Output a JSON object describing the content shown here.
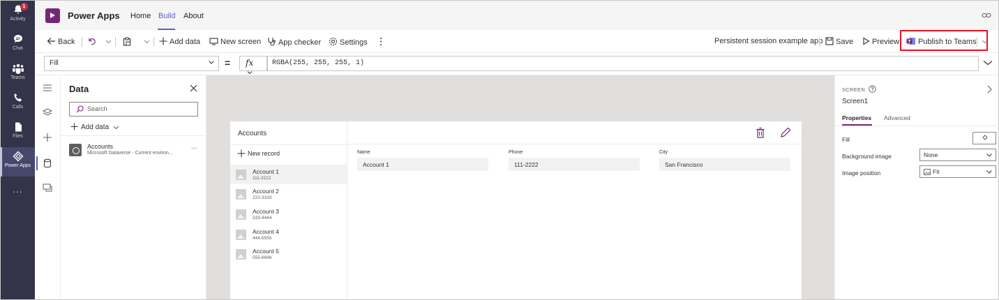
{
  "rail": {
    "items": [
      {
        "label": "Activity",
        "icon": "bell-icon",
        "badge": "1"
      },
      {
        "label": "Chat",
        "icon": "chat-icon"
      },
      {
        "label": "Teams",
        "icon": "teams-icon"
      },
      {
        "label": "Calls",
        "icon": "phone-icon"
      },
      {
        "label": "Files",
        "icon": "file-icon"
      },
      {
        "label": "Power Apps",
        "icon": "power-apps-icon"
      }
    ],
    "more": "..."
  },
  "header": {
    "app_name": "Power Apps",
    "tabs": [
      "Home",
      "Build",
      "About"
    ],
    "active_tab": "Build"
  },
  "toolbar": {
    "back": "Back",
    "add_data": "Add data",
    "new_screen": "New screen",
    "app_checker": "App checker",
    "settings": "Settings",
    "app_name": "Persistent session example app",
    "save": "Save",
    "preview": "Preview",
    "publish": "Publish to Teams"
  },
  "formula": {
    "property": "Fill",
    "fx": "fx",
    "expression": "RGBA(255, 255, 255, 1)"
  },
  "data_pane": {
    "title": "Data",
    "search_placeholder": "Search",
    "add_data": "Add data",
    "sources": [
      {
        "name": "Accounts",
        "subtitle": "Microsoft Dataverse - Current environ..."
      }
    ],
    "more": "..."
  },
  "canvas": {
    "gallery_title": "Accounts",
    "new_record": "New record",
    "records": [
      {
        "name": "Account 1",
        "phone": "111-2222"
      },
      {
        "name": "Account 2",
        "phone": "222-3333"
      },
      {
        "name": "Account 3",
        "phone": "333-4444"
      },
      {
        "name": "Account 4",
        "phone": "444-5555"
      },
      {
        "name": "Account 5",
        "phone": "555-6666"
      }
    ],
    "selected_index": 0,
    "form": {
      "fields": [
        {
          "label": "Name",
          "value": "Account 1"
        },
        {
          "label": "Phone",
          "value": "111-2222"
        },
        {
          "label": "City",
          "value": "San Francisco"
        }
      ]
    }
  },
  "properties": {
    "kind": "SCREEN",
    "name": "Screen1",
    "tabs": [
      "Properties",
      "Advanced"
    ],
    "active_tab": "Properties",
    "rows": [
      {
        "label": "Fill"
      },
      {
        "label": "Background image",
        "value": "None"
      },
      {
        "label": "Image position",
        "value": "Fit"
      }
    ]
  },
  "colors": {
    "rail_bg": "#33344a",
    "accent": "#5b5fc7",
    "brand": "#742774",
    "highlight_box": "#e81123",
    "canvas_bg": "#e1dfdd"
  }
}
